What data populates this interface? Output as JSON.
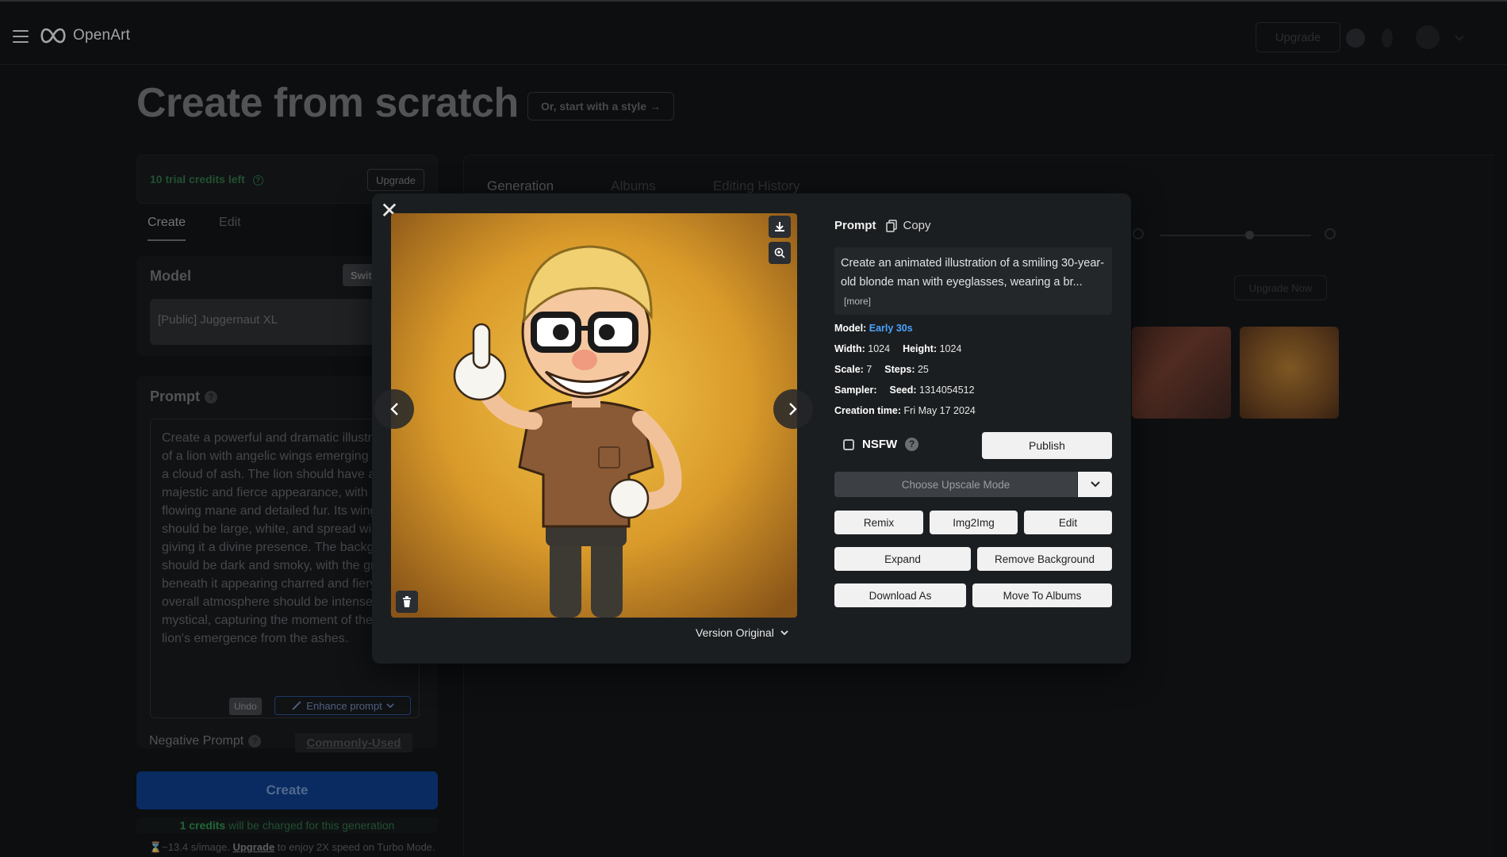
{
  "app": {
    "logo_text": "OpenArt",
    "upgrade_label": "Upgrade"
  },
  "page": {
    "title": "Create from scratch",
    "style_button": "Or, start with a style →"
  },
  "left": {
    "credits_text": "10 trial credits left",
    "credits_upgrade": "Upgrade",
    "tabs": [
      {
        "label": "Create",
        "active": true
      },
      {
        "label": "Edit",
        "active": false
      }
    ],
    "model_label": "Model",
    "switch_label": "Swit",
    "model_value": "[Public] Juggernaut XL",
    "prompt_label": "Prompt",
    "prompt_text": "Create a powerful and dramatic illustration of a lion with angelic wings emerging from a cloud of ash. The lion should have a majestic and fierce appearance, with a flowing mane and detailed fur. Its wings should be large, white, and spread wide, giving it a divine presence. The background should be dark and smoky, with the ground beneath it appearing charred and fiery. The overall atmosphere should be intense and mystical, capturing the moment of the angel lion's emergence from the ashes.",
    "undo": "Undo",
    "enhance": "Enhance prompt",
    "negative_prompt": "Negative Prompt",
    "commonly_used": "Commonly-Used",
    "create": "Create",
    "charge_bold": "1 credits",
    "charge_rest": " will be charged for this generation",
    "speed_prefix": "⌛~13.4 s/image. ",
    "speed_upgrade": "Upgrade",
    "speed_suffix": " to enjoy 2X speed on Turbo Mode."
  },
  "right": {
    "tabs": [
      {
        "label": "Generation",
        "active": true
      },
      {
        "label": "Albums",
        "active": false
      },
      {
        "label": "Editing History",
        "active": false
      }
    ],
    "upgrade_now": "Upgrade Now"
  },
  "modal": {
    "prompt_label": "Prompt",
    "copy_label": "Copy",
    "prompt_text": "Create an animated illustration of a smiling 30-year-old blonde man with eyeglasses, wearing a br...",
    "more": "[more]",
    "model_key": "Model:",
    "model_value": "Early 30s",
    "width_key": "Width:",
    "width_value": "1024",
    "height_key": "Height:",
    "height_value": "1024",
    "scale_key": "Scale:",
    "scale_value": "7",
    "steps_key": "Steps:",
    "steps_value": "25",
    "sampler_key": "Sampler:",
    "seed_key": "Seed:",
    "seed_value": "1314054512",
    "creation_key": "Creation time:",
    "creation_value": "Fri May 17 2024",
    "nsfw": "NSFW",
    "publish": "Publish",
    "upscale_placeholder": "Choose Upscale Mode",
    "buttons": {
      "remix": "Remix",
      "img2img": "Img2Img",
      "edit": "Edit",
      "expand": "Expand",
      "remove_bg": "Remove Background",
      "download_as": "Download As",
      "move_to_albums": "Move To Albums"
    },
    "version": "Version Original"
  }
}
